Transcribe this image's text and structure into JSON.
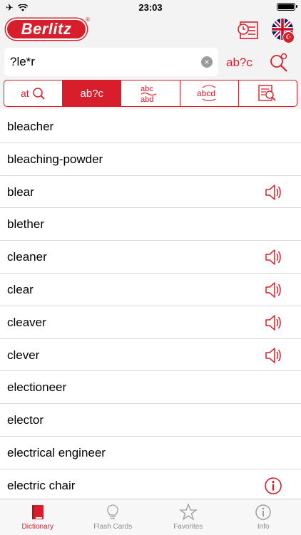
{
  "status": {
    "time": "23:03"
  },
  "header": {
    "logo": "Berlitz",
    "registered": "®"
  },
  "search": {
    "value": "?le*r",
    "mode_label": "ab?c"
  },
  "segments": [
    {
      "label": "at",
      "name": "word-search"
    },
    {
      "label": "ab?c",
      "name": "wildcard-search"
    },
    {
      "label": "abc/abd",
      "name": "fuzzy-search"
    },
    {
      "label": "abcd",
      "name": "anagram-search"
    },
    {
      "label": "fulltext",
      "name": "fulltext-search"
    }
  ],
  "words": [
    {
      "text": "bleacher",
      "icon": ""
    },
    {
      "text": "bleaching-powder",
      "icon": ""
    },
    {
      "text": "blear",
      "icon": "speaker-icon"
    },
    {
      "text": "blether",
      "icon": ""
    },
    {
      "text": "cleaner",
      "icon": "speaker-icon"
    },
    {
      "text": "clear",
      "icon": "speaker-icon"
    },
    {
      "text": "cleaver",
      "icon": "speaker-icon"
    },
    {
      "text": "clever",
      "icon": "speaker-icon"
    },
    {
      "text": "electioneer",
      "icon": ""
    },
    {
      "text": "elector",
      "icon": ""
    },
    {
      "text": "electrical engineer",
      "icon": ""
    },
    {
      "text": "electric chair",
      "icon": "info-icon"
    }
  ],
  "tabs": [
    {
      "label": "Dictionary",
      "icon": "book-icon",
      "active": true
    },
    {
      "label": "Flash Cards",
      "icon": "lightbulb-icon",
      "active": false
    },
    {
      "label": "Favorites",
      "icon": "star-icon",
      "active": false
    },
    {
      "label": "Info",
      "icon": "info-icon",
      "active": false
    }
  ],
  "colors": {
    "accent": "#d81e2a",
    "background": "#f3f3f3",
    "tab_inactive": "#8e8e8e"
  }
}
